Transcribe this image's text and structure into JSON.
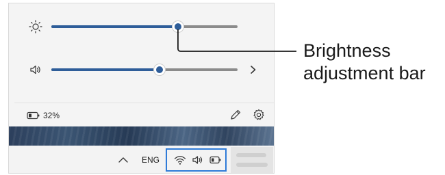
{
  "quick_settings": {
    "brightness": {
      "icon": "sun-icon",
      "value_percent": 68
    },
    "volume": {
      "icon": "speaker-icon",
      "value_percent": 58
    },
    "battery": {
      "icon": "battery-icon",
      "label": "32%"
    },
    "edit_icon": "pencil-icon",
    "settings_icon": "gear-icon"
  },
  "taskbar": {
    "chevron_icon": "chevron-up-icon",
    "language": "ENG",
    "tray_icons": [
      "wifi-icon",
      "speaker-icon",
      "battery-icon"
    ],
    "tray_highlight_color": "#2f7bd8"
  },
  "annotation": {
    "line1": "Brightness",
    "line2": "adjustment bar"
  },
  "colors": {
    "accent": "#2e5d99",
    "track": "#8b8b8b",
    "panel": "#f4f4f4"
  }
}
